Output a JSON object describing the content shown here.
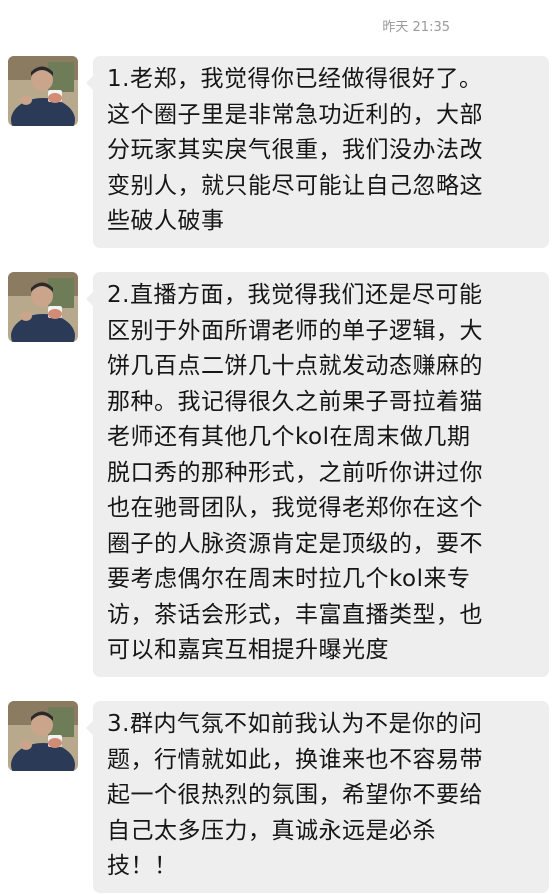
{
  "timestamp": "昨天 21:35",
  "messages": [
    {
      "lines": [
        "1.老郑，我觉得你已经做得很好了。",
        "这个圈子里是非常急功近利的，大部",
        "分玩家其实戾气很重，我们没办法改",
        "变别人，就只能尽可能让自己忽略这",
        "些破人破事"
      ]
    },
    {
      "lines": [
        "2.直播方面，我觉得我们还是尽可能",
        "区别于外面所谓老师的单子逻辑，大",
        "饼几百点二饼几十点就发动态赚麻的",
        "那种。我记得很久之前果子哥拉着猫",
        "老师还有其他几个kol在周末做几期",
        "脱口秀的那种形式，之前听你讲过你",
        "也在驰哥团队，我觉得老郑你在这个",
        "圈子的人脉资源肯定是顶级的，要不",
        "要考虑偶尔在周末时拉几个kol来专",
        "访，茶话会形式，丰富直播类型，也",
        "可以和嘉宾互相提升曝光度"
      ]
    },
    {
      "lines": [
        "3.群内气氛不如前我认为不是你的问",
        "题，行情就如此，换谁来也不容易带",
        "起一个很热烈的氛围，希望你不要给",
        "自己太多压力，真诚永远是必杀",
        "技！！"
      ]
    }
  ],
  "colors": {
    "bubble_bg": "#eeeeee",
    "text": "#161616",
    "timestamp": "#9a9a9a",
    "page_bg": "#ffffff"
  },
  "avatar_icon": "user-photo-avatar"
}
